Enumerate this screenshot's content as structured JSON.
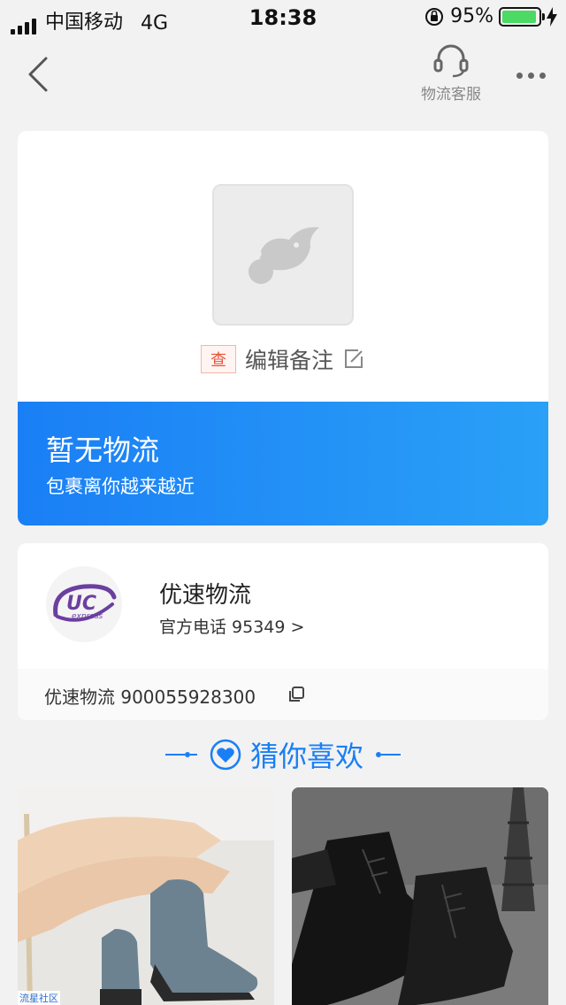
{
  "status_bar": {
    "carrier": "中国移动",
    "network": "4G",
    "time": "18:38",
    "battery_pct": "95%",
    "battery_level": 0.95
  },
  "nav": {
    "customer_service_label": "物流客服",
    "icons": [
      "back-chevron-icon",
      "headset-icon",
      "more-dots-icon"
    ]
  },
  "package": {
    "badge": "查",
    "note_label": "编辑备注"
  },
  "banner": {
    "title": "暂无物流",
    "subtitle": "包裹离你越来越近",
    "gradient": [
      "#1a7ff5",
      "#2aa0f7"
    ]
  },
  "courier": {
    "logo_text": "UC",
    "logo_sub": "express",
    "name": "优速物流",
    "phone_label": "官方电话 95349 >",
    "tracking": "优速物流 900055928300",
    "logo_color": "#6b3fa0"
  },
  "recommend": {
    "title": "猜你喜欢"
  },
  "products": [
    {
      "name": "gray-wedge-ankle-boot"
    },
    {
      "name": "black-lace-up-ankle-boot"
    }
  ],
  "watermark": "流星社区",
  "colors": {
    "accent": "#1a7ff5",
    "badge_red": "#e5533d"
  }
}
